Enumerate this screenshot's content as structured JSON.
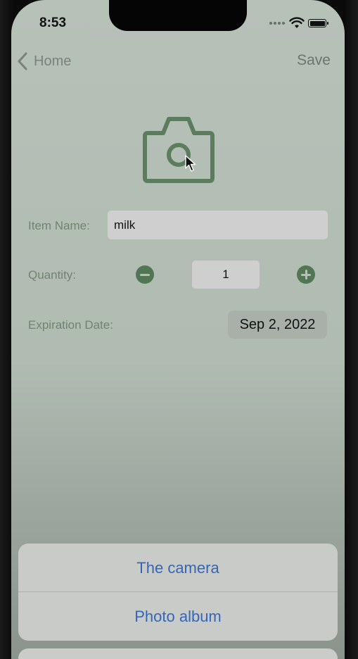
{
  "status_bar": {
    "time": "8:53"
  },
  "nav": {
    "back_label": "Home",
    "save_label": "Save"
  },
  "form": {
    "item_name_label": "Item Name:",
    "item_name_value": "milk",
    "quantity_label": "Quantity:",
    "quantity_value": "1",
    "expiration_label": "Expiration Date:",
    "expiration_value": "Sep 2, 2022"
  },
  "action_sheet": {
    "options": [
      {
        "label": "The camera"
      },
      {
        "label": "Photo album"
      }
    ]
  },
  "colors": {
    "accent_green": "#527653",
    "label_green": "#6f8470",
    "action_blue": "#3467b8"
  }
}
